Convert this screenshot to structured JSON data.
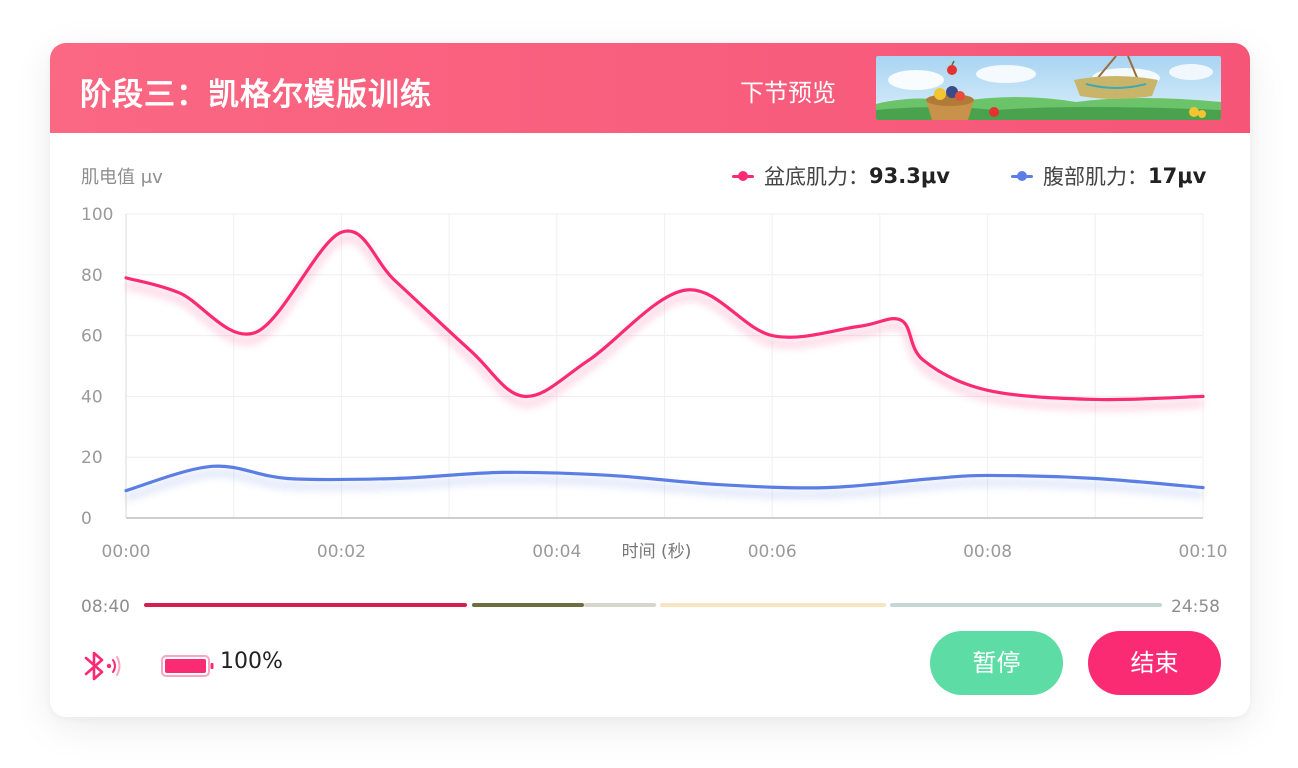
{
  "header": {
    "title": "阶段三：凯格尔模版训练",
    "next_preview_label": "下节预览"
  },
  "chart": {
    "ylabel": "肌电值 μv",
    "legend": [
      {
        "label": "盆底肌力：",
        "value": "93.3μv",
        "color": "#fb2b73"
      },
      {
        "label": "腹部肌力：",
        "value": "17μv",
        "color": "#5b7ee5"
      }
    ]
  },
  "chart_data": {
    "type": "line",
    "xlabel": "时间 (秒)",
    "ylabel": "肌电值 μv",
    "x_ticks": [
      "00:00",
      "00:02",
      "00:04",
      "00:06",
      "00:08",
      "00:10"
    ],
    "y_ticks": [
      "0",
      "20",
      "40",
      "60",
      "80",
      "100"
    ],
    "xlim": [
      0,
      10
    ],
    "ylim": [
      0,
      100
    ],
    "grid": true,
    "series": [
      {
        "name": "盆底肌力",
        "color": "#fb2b73",
        "x": [
          0,
          0.5,
          1.2,
          2.0,
          2.5,
          3.2,
          3.7,
          4.3,
          5.2,
          6.0,
          6.8,
          7.2,
          7.4,
          8.0,
          9.0,
          10.0
        ],
        "y": [
          79,
          74,
          61,
          94,
          78,
          55,
          40,
          52,
          75,
          60,
          63,
          65,
          52,
          42,
          39,
          40
        ]
      },
      {
        "name": "腹部肌力",
        "color": "#5b7ee5",
        "x": [
          0,
          0.8,
          1.5,
          2.5,
          3.5,
          4.5,
          5.5,
          6.5,
          7.5,
          8.0,
          9.0,
          10.0
        ],
        "y": [
          9,
          17,
          13,
          13,
          15,
          14,
          11,
          10,
          13,
          14,
          13,
          10
        ]
      }
    ]
  },
  "progress": {
    "start_time": "08:40",
    "end_time": "24:58"
  },
  "status": {
    "battery": "100%"
  },
  "buttons": {
    "pause": "暂停",
    "end": "结束"
  },
  "colors": {
    "header": "#f65578",
    "pelvic_series": "#fb2b73",
    "abdominal_series": "#5b7ee5",
    "pause_button": "#5ddca5",
    "end_button": "#fb2b73"
  }
}
